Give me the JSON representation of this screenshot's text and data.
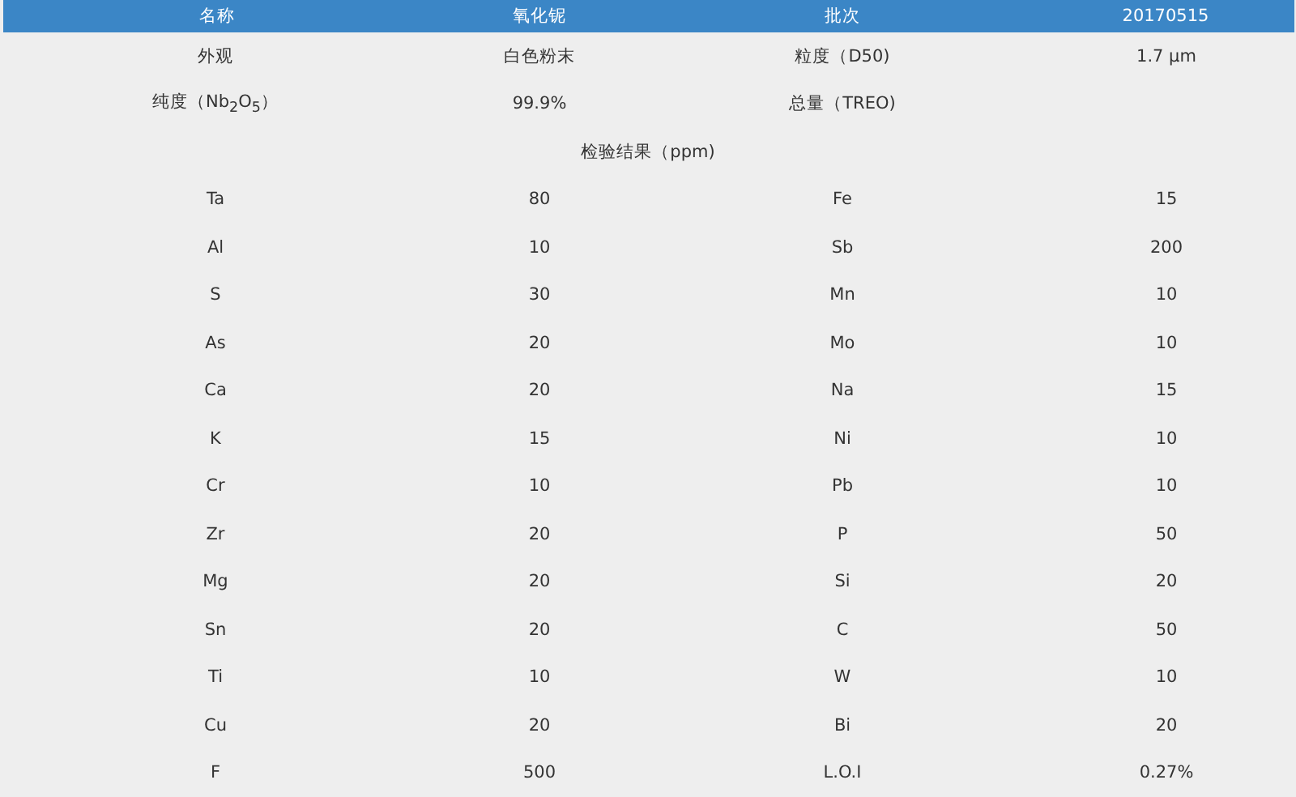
{
  "header": [
    "名称",
    "氧化铌",
    "批次",
    "20170515"
  ],
  "info_rows": [
    [
      "外观",
      "白色粉末",
      "粒度（D50)",
      "1.7 µm"
    ],
    [
      "纯度（Nb$_{2}$O$_{5}$）",
      "99.9%",
      "总量（TREO)"
    ]
  ],
  "results_title": "检验结果（ppm)",
  "results": [
    [
      "Ta",
      "80",
      "Fe",
      "15"
    ],
    [
      "Al",
      "10",
      "Sb",
      "200"
    ],
    [
      "S",
      "30",
      "Mn",
      "10"
    ],
    [
      "As",
      "20",
      "Mo",
      "10"
    ],
    [
      "Ca",
      "20",
      "Na",
      "15"
    ],
    [
      "K",
      "15",
      "Ni",
      "10"
    ],
    [
      "Cr",
      "10",
      "Pb",
      "10"
    ],
    [
      "Zr",
      "20",
      "P",
      "50"
    ],
    [
      "Mg",
      "20",
      "Si",
      "20"
    ],
    [
      "Sn",
      "20",
      "C",
      "50"
    ],
    [
      "Ti",
      "10",
      "W",
      "10"
    ],
    [
      "Cu",
      "20",
      "Bi",
      "20"
    ],
    [
      "F",
      "500",
      "L.O.I",
      "0.27%"
    ]
  ]
}
